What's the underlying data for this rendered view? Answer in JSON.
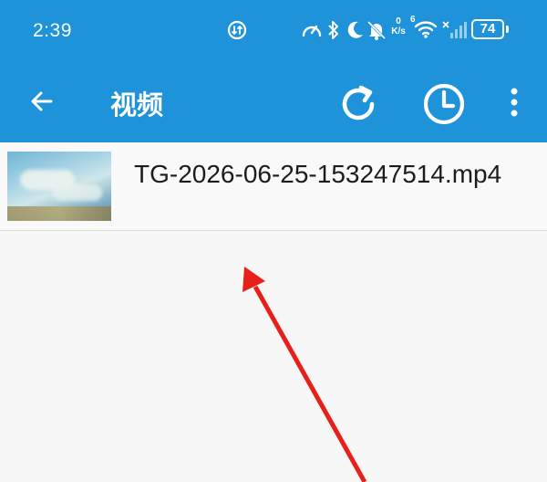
{
  "status_bar": {
    "time": "2:39",
    "net_speed_value": "0",
    "net_speed_unit": "K/s",
    "wifi_label": "6",
    "battery": "74",
    "icons": [
      "data-saver-icon",
      "speedometer-icon",
      "bluetooth-icon",
      "moon-icon",
      "mute-icon",
      "wifi-icon",
      "signal-icon",
      "battery-icon"
    ]
  },
  "app_bar": {
    "title": "视频",
    "icons": [
      "back-arrow-icon",
      "refresh-icon",
      "history-clock-icon",
      "more-vert-icon"
    ]
  },
  "files": [
    {
      "name": "TG-2026-06-25-153247514.mp4"
    }
  ],
  "colors": {
    "app_bar": "#1e93d9",
    "arrow": "#e8201a",
    "background": "#f7f7f7"
  }
}
